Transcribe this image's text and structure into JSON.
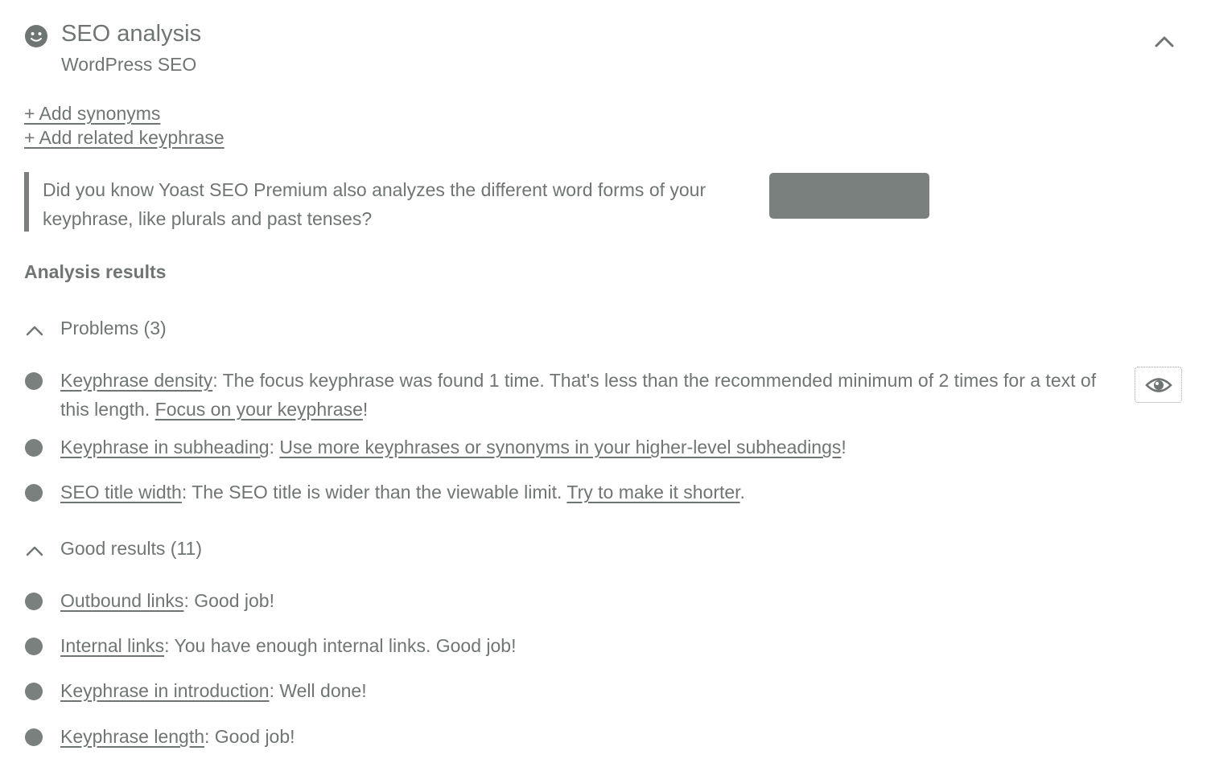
{
  "panel": {
    "title": "SEO analysis",
    "subtitle": "WordPress SEO",
    "header_icon": "smiley-face-icon",
    "collapse_icon": "chevron-up-icon"
  },
  "keyphrase_links": {
    "add_synonyms": "+ Add synonyms",
    "add_related": "+ Add related keyphrase"
  },
  "callout": {
    "text": "Did you know Yoast SEO Premium also analyzes the different word forms of your keyphrase, like plurals and past tenses?",
    "button_label": ""
  },
  "analysis": {
    "heading": "Analysis results",
    "problems": {
      "label": "Problems (3)",
      "items": [
        {
          "link": "Keyphrase density",
          "sep": ": ",
          "text": "The focus keyphrase was found 1 time. That's less than the recommended minimum of 2 times for a text of this length. ",
          "action": "Focus on your keyphrase",
          "end": "!"
        },
        {
          "link": "Keyphrase in subheading",
          "sep": ": ",
          "text": "",
          "action": "Use more keyphrases or synonyms in your higher-level subheadings",
          "end": "!"
        },
        {
          "link": "SEO title width",
          "sep": ": ",
          "text": "The SEO title is wider than the viewable limit. ",
          "action": "Try to make it shorter",
          "end": "."
        }
      ]
    },
    "good": {
      "label": "Good results (11)",
      "items": [
        {
          "link": "Outbound links",
          "sep": ": ",
          "text": "Good job!"
        },
        {
          "link": "Internal links",
          "sep": ": ",
          "text": "You have enough internal links. Good job!"
        },
        {
          "link": "Keyphrase in introduction",
          "sep": ": ",
          "text": "Well done!"
        },
        {
          "link": "Keyphrase length",
          "sep": ": ",
          "text": "Good job!"
        }
      ]
    }
  },
  "icons": {
    "eye": "eye-icon",
    "group_chevron": "chevron-up-icon",
    "bullet": "score-bullet-icon"
  },
  "colors": {
    "text": "#6f7572",
    "bullet": "#7a807d",
    "button": "#7a807d"
  }
}
